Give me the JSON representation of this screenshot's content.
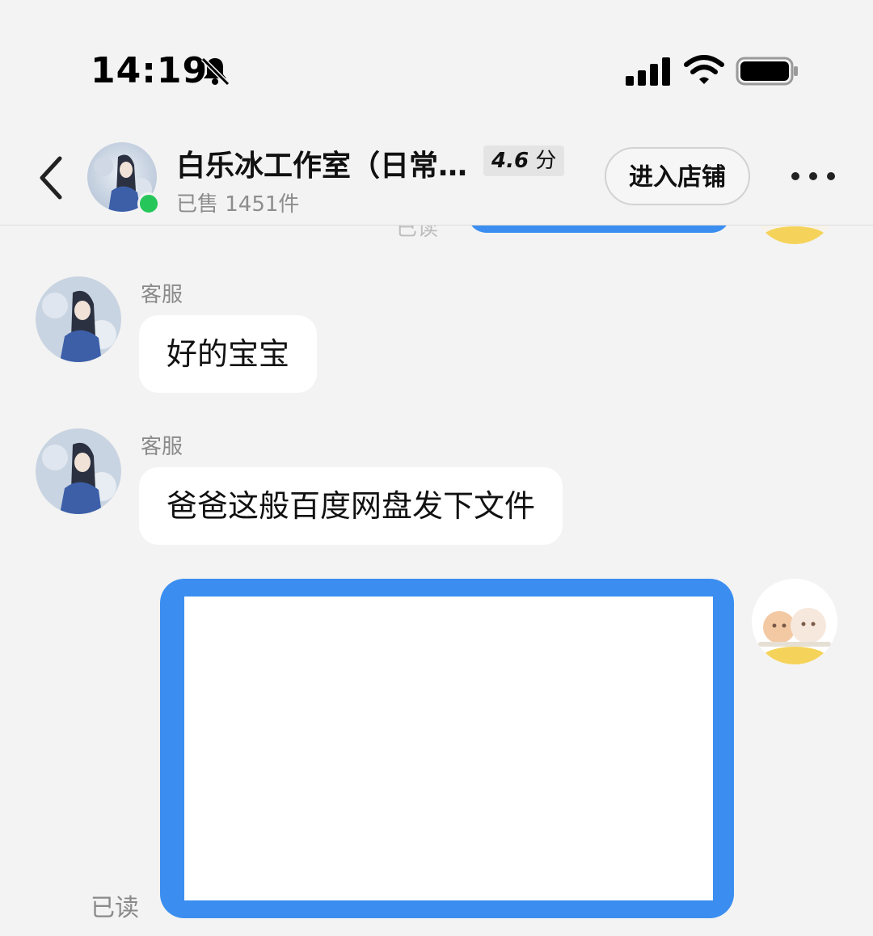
{
  "status_bar": {
    "time": "14:19",
    "icons": [
      "bell-muted-icon",
      "cellular-signal-icon",
      "wifi-icon",
      "battery-icon"
    ]
  },
  "header": {
    "back_icon": "chevron-left-icon",
    "shop_name": "白乐冰工作室（日常…",
    "rating_value": "4.6",
    "rating_unit": "分",
    "sold_text": "已售 1451件",
    "enter_shop_label": "进入店铺",
    "more_icon": "more-dots-icon",
    "online_status_color": "#27c65a"
  },
  "previous_message": {
    "read_status": "已读"
  },
  "messages": [
    {
      "sender": "客服",
      "text": "好的宝宝",
      "side": "left"
    },
    {
      "sender": "客服",
      "text": "爸爸这般百度网盘发下文件",
      "side": "left"
    },
    {
      "type": "image",
      "side": "right",
      "read_status": "已读"
    }
  ],
  "colors": {
    "accent_blue": "#3b8ef0",
    "background": "#f3f3f3",
    "bubble": "#ffffff"
  }
}
